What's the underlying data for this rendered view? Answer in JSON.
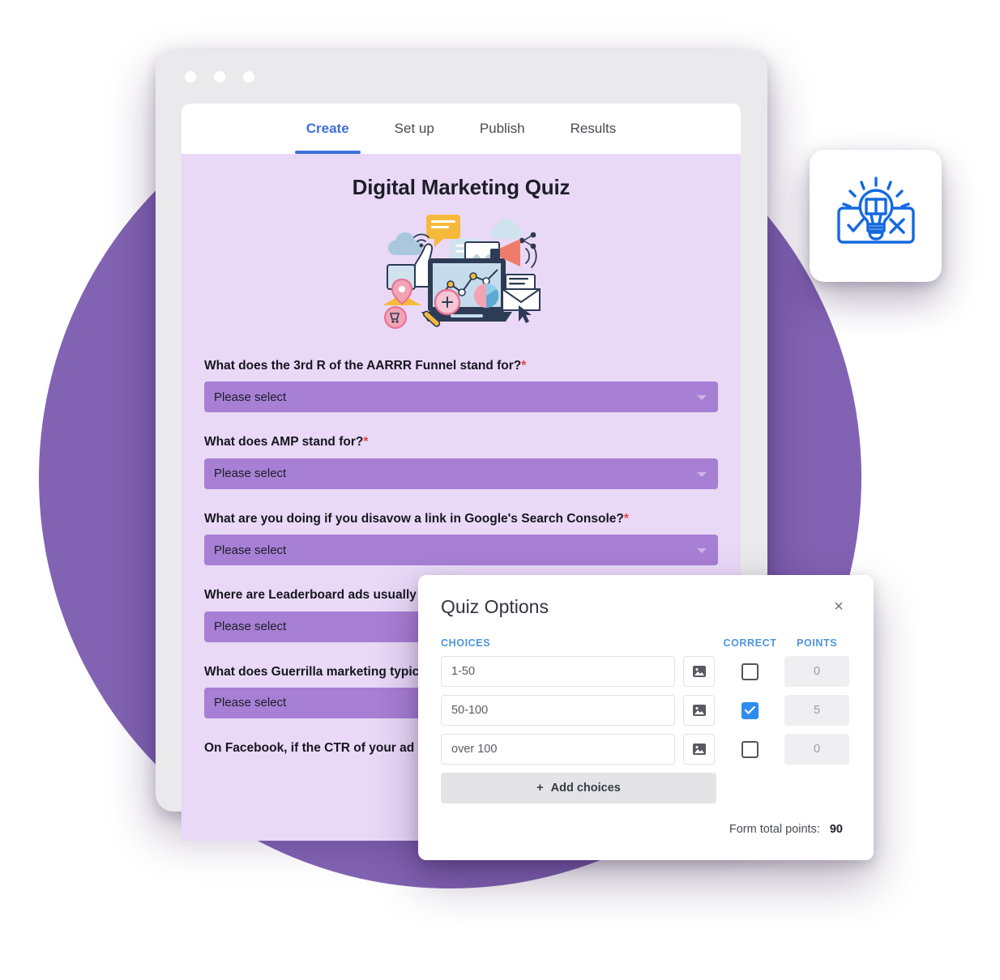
{
  "window": {
    "dots": [
      "close-dot",
      "minimize-dot",
      "maximize-dot"
    ]
  },
  "tabs": [
    {
      "label": "Create",
      "active": true
    },
    {
      "label": "Set up",
      "active": false
    },
    {
      "label": "Publish",
      "active": false
    },
    {
      "label": "Results",
      "active": false
    }
  ],
  "quiz": {
    "title": "Digital Marketing Quiz",
    "hero_icon": "digital-marketing-illustration",
    "select_placeholder": "Please select",
    "required_marker": "*",
    "questions": [
      {
        "text": "What does the 3rd R of the AARRR Funnel stand for?",
        "required": true,
        "value": "Please select"
      },
      {
        "text": "What does AMP stand for?",
        "required": true,
        "value": "Please select"
      },
      {
        "text": "What are you doing if you disavow a link in Google's Search Console?",
        "required": true,
        "value": "Please select"
      },
      {
        "text": "Where are Leaderboard ads usually placed?",
        "required": false,
        "value": "Please select"
      },
      {
        "text": "What does Guerrilla marketing typically involve?",
        "required": false,
        "value": "Please select"
      },
      {
        "text": "On Facebook, if the CTR of your ad increases what happens to the CPC?",
        "required": true,
        "value": ""
      }
    ]
  },
  "icon_card": {
    "icon": "quiz-lightbulb-icon",
    "accent": "#1569e0"
  },
  "modal": {
    "title": "Quiz Options",
    "close_label": "×",
    "columns": {
      "choices": "CHOICES",
      "correct": "CORRECT",
      "points": "POINTS"
    },
    "choices": [
      {
        "text": "1-50",
        "correct": false,
        "points": "0"
      },
      {
        "text": "50-100",
        "correct": true,
        "points": "5"
      },
      {
        "text": "over 100",
        "correct": false,
        "points": "0"
      }
    ],
    "add_choices_label": "Add choices",
    "add_icon": "plus-icon",
    "image_icon": "image-icon",
    "total_label": "Form total points:",
    "total_value": "90"
  },
  "colors": {
    "accent_blue": "#3d6fd9",
    "header_blue": "#4f95dd",
    "checkbox_blue": "#2d8cf0",
    "page_lavender": "#e9d9f7",
    "select_purple": "#a77fd4",
    "blob_purple": "#8263b3",
    "required_red": "#e8413f"
  }
}
